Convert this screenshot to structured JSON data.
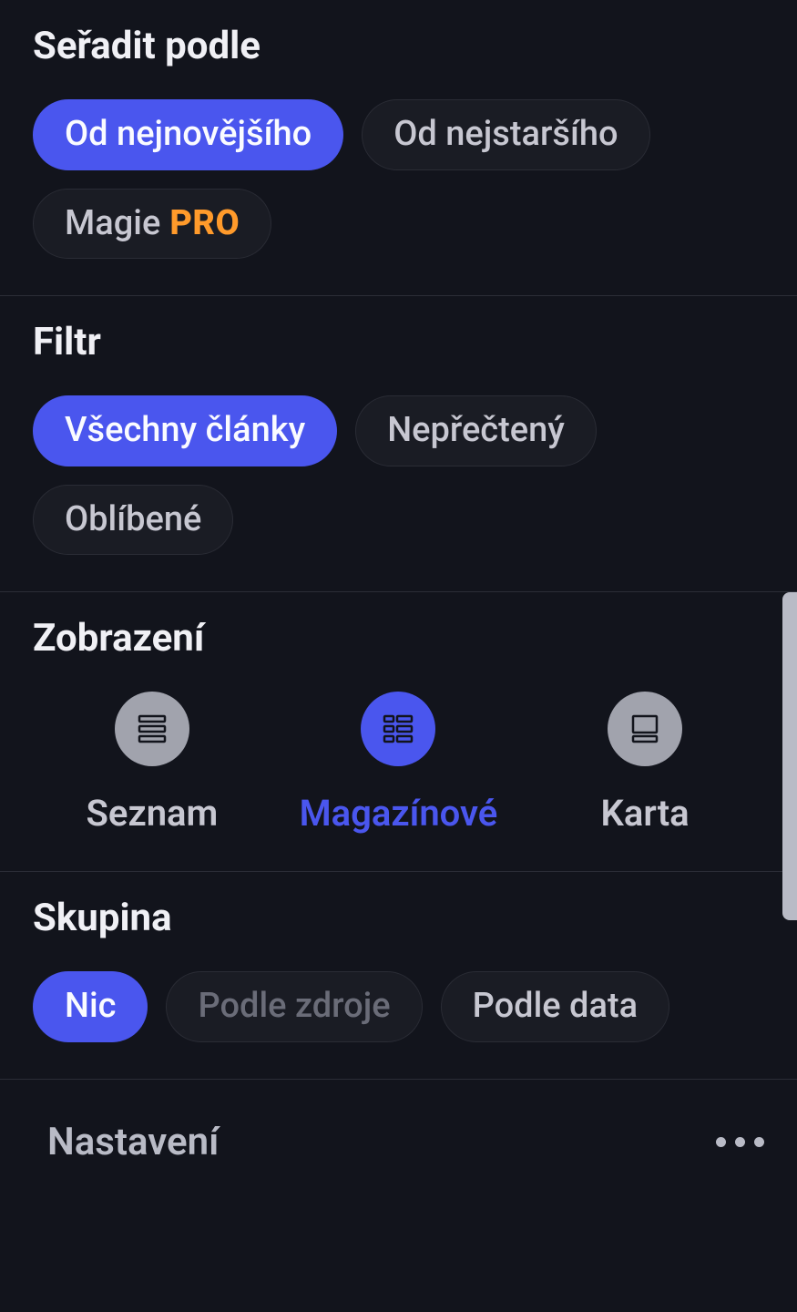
{
  "sort": {
    "title": "Seřadit podle",
    "options": [
      {
        "label": "Od nejnovějšího",
        "selected": true,
        "pro": false
      },
      {
        "label": "Od nejstaršího",
        "selected": false,
        "pro": false
      },
      {
        "label": "Magie",
        "selected": false,
        "pro": true,
        "pro_badge": "PRO"
      }
    ]
  },
  "filter": {
    "title": "Filtr",
    "options": [
      {
        "label": "Všechny články",
        "selected": true
      },
      {
        "label": "Nepřečtený",
        "selected": false
      },
      {
        "label": "Oblíbené",
        "selected": false
      }
    ]
  },
  "view": {
    "title": "Zobrazení",
    "options": [
      {
        "label": "Seznam",
        "icon": "list",
        "selected": false
      },
      {
        "label": "Magazínové",
        "icon": "magazine",
        "selected": true
      },
      {
        "label": "Karta",
        "icon": "card",
        "selected": false
      }
    ]
  },
  "group": {
    "title": "Skupina",
    "options": [
      {
        "label": "Nic",
        "selected": true,
        "disabled": false
      },
      {
        "label": "Podle zdroje",
        "selected": false,
        "disabled": true
      },
      {
        "label": "Podle data",
        "selected": false,
        "disabled": false
      }
    ]
  },
  "settings": {
    "label": "Nastavení"
  }
}
